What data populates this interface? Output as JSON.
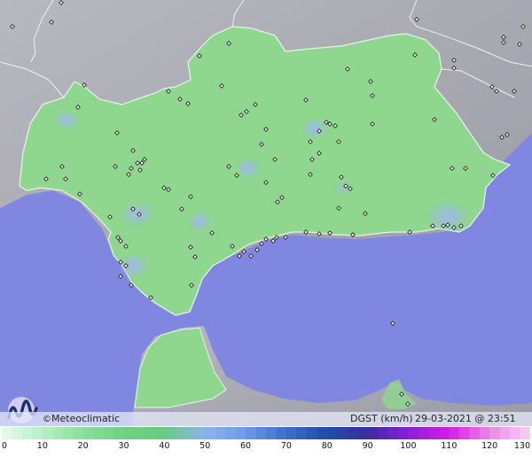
{
  "branding": {
    "copyright_symbol": "©",
    "name": "Meteoclimatic"
  },
  "variable": "DGST (km/h)",
  "timestamp": "29-03-2021 @ 23:51 UTC",
  "colors": {
    "sea": "#7f87e0",
    "land_outside": "#a9a9b1",
    "region_fill": "#8fd68f",
    "gust_highlight": "#9ab4ee",
    "border": "#f2f2f2"
  },
  "scale": {
    "unit": "km/h",
    "min": 0,
    "max": 130,
    "ticks": [
      "0",
      "10",
      "20",
      "30",
      "40",
      "50",
      "60",
      "70",
      "80",
      "90",
      "100",
      "110",
      "120",
      "130"
    ],
    "stops": [
      {
        "value": 0,
        "color": "#e6faf0"
      },
      {
        "value": 10,
        "color": "#b6f0c4"
      },
      {
        "value": 20,
        "color": "#88e09c"
      },
      {
        "value": 30,
        "color": "#6ed27f"
      },
      {
        "value": 40,
        "color": "#66cc80"
      },
      {
        "value": 50,
        "color": "#8ab4ef"
      },
      {
        "value": 60,
        "color": "#6a9ce6"
      },
      {
        "value": 70,
        "color": "#3a6fcb"
      },
      {
        "value": 80,
        "color": "#1f4fa8"
      },
      {
        "value": 90,
        "color": "#3a2c9e"
      },
      {
        "value": 100,
        "color": "#8a1fd8"
      },
      {
        "value": 110,
        "color": "#d21ee0"
      },
      {
        "value": 120,
        "color": "#ec86ea"
      },
      {
        "value": 130,
        "color": "#f7d3f4"
      }
    ]
  }
}
